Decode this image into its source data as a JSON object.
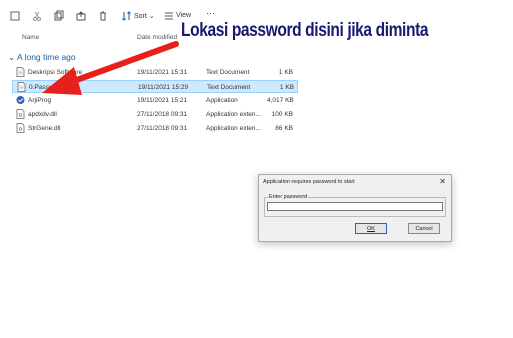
{
  "toolbar": {
    "sort_label": "Sort",
    "view_label": "View"
  },
  "columns": {
    "name": "Name",
    "date_modified": "Date modified"
  },
  "group_label": "A long time ago",
  "files": [
    {
      "name": "Deskripsi Software",
      "date": "19/11/2021 15:31",
      "type": "Text Document",
      "size": "1 KB",
      "icon": "text-file-icon",
      "selected": false
    },
    {
      "name": "0.Password",
      "date": "19/11/2021 15:29",
      "type": "Text Document",
      "size": "1 KB",
      "icon": "text-file-icon",
      "selected": true
    },
    {
      "name": "ArjiProg",
      "date": "19/11/2021 15:21",
      "type": "Application",
      "size": "4,017 KB",
      "icon": "app-icon",
      "selected": false
    },
    {
      "name": "apdxdv.dll",
      "date": "27/11/2018 09:31",
      "type": "Application exten...",
      "size": "100 KB",
      "icon": "dll-file-icon",
      "selected": false
    },
    {
      "name": "StrGene.dll",
      "date": "27/11/2018 09:31",
      "type": "Application exten...",
      "size": "86 KB",
      "icon": "dll-file-icon",
      "selected": false
    }
  ],
  "annotation": "Lokasi password disini jika diminta",
  "dialog": {
    "title": "Application requires password to start",
    "close": "✕",
    "group_label": "Enter password",
    "password_value": "",
    "ok_label": "OK",
    "cancel_label": "Cancel"
  },
  "colors": {
    "arrow": "#e8201c",
    "selection": "#cde8ff",
    "annotation": "#1a1a70"
  }
}
